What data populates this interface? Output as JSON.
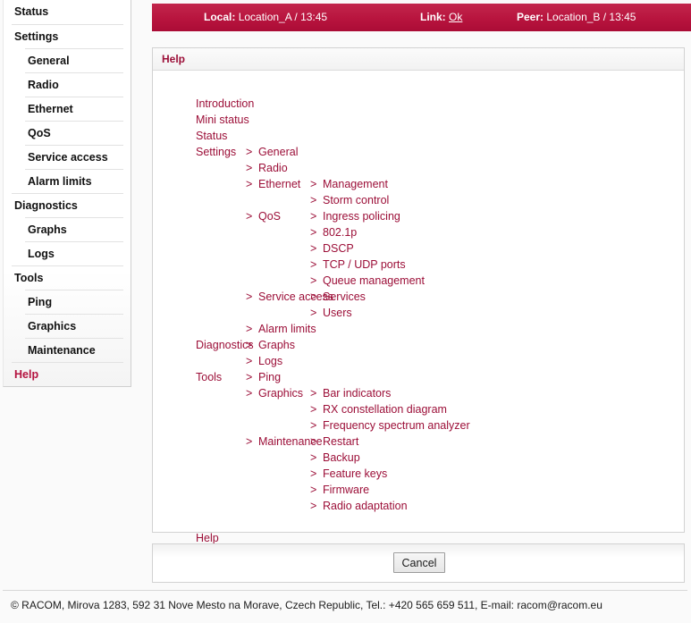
{
  "statusbar": {
    "local_key": "Local:",
    "local_value": "Location_A / 13:45",
    "link_key": "Link:",
    "link_value": "Ok",
    "peer_key": "Peer:",
    "peer_value": "Location_B / 13:45",
    "accent_color": "#b8143e"
  },
  "sidebar": {
    "items": [
      {
        "label": "Status",
        "level": 0,
        "active": false
      },
      {
        "label": "Settings",
        "level": 0,
        "active": false
      },
      {
        "label": "General",
        "level": 1,
        "active": false
      },
      {
        "label": "Radio",
        "level": 1,
        "active": false
      },
      {
        "label": "Ethernet",
        "level": 1,
        "active": false
      },
      {
        "label": "QoS",
        "level": 1,
        "active": false
      },
      {
        "label": "Service access",
        "level": 1,
        "active": false
      },
      {
        "label": "Alarm limits",
        "level": 1,
        "active": false
      },
      {
        "label": "Diagnostics",
        "level": 0,
        "active": false
      },
      {
        "label": "Graphs",
        "level": 1,
        "active": false
      },
      {
        "label": "Logs",
        "level": 1,
        "active": false
      },
      {
        "label": "Tools",
        "level": 0,
        "active": false
      },
      {
        "label": "Ping",
        "level": 1,
        "active": false
      },
      {
        "label": "Graphics",
        "level": 1,
        "active": false
      },
      {
        "label": "Maintenance",
        "level": 1,
        "active": false
      },
      {
        "label": "Help",
        "level": 0,
        "active": true
      }
    ]
  },
  "panel": {
    "title": "Help",
    "title_color": "#9c0f38",
    "link_color": "#9c0f38",
    "separator": ">"
  },
  "help_tree": {
    "rows": [
      {
        "col0": "Introduction"
      },
      {
        "col0": "Mini status"
      },
      {
        "col0": "Status"
      },
      {
        "col0": "Settings",
        "col1": "General"
      },
      {
        "col1": "Radio"
      },
      {
        "col1": "Ethernet",
        "col2": "Management"
      },
      {
        "col2": "Storm control"
      },
      {
        "col1": "QoS",
        "col2": "Ingress policing"
      },
      {
        "col2": "802.1p"
      },
      {
        "col2": "DSCP"
      },
      {
        "col2": "TCP / UDP ports"
      },
      {
        "col2": "Queue management"
      },
      {
        "col1": "Service access",
        "col2": "Services"
      },
      {
        "col2": "Users"
      },
      {
        "col1": "Alarm limits"
      },
      {
        "col0": "Diagnostics",
        "col1": "Graphs"
      },
      {
        "col1": "Logs"
      },
      {
        "col0": "Tools",
        "col1": "Ping"
      },
      {
        "col1": "Graphics",
        "col2": "Bar indicators"
      },
      {
        "col2": "RX constellation diagram"
      },
      {
        "col2": "Frequency spectrum analyzer"
      },
      {
        "col1": "Maintenance",
        "col2": "Restart"
      },
      {
        "col2": "Backup"
      },
      {
        "col2": "Feature keys"
      },
      {
        "col2": "Firmware"
      },
      {
        "col2": "Radio adaptation"
      },
      {
        "col0": ""
      },
      {
        "col0": "Help"
      }
    ]
  },
  "actions": {
    "cancel_label": "Cancel"
  },
  "footer": {
    "text": "© RACOM, Mirova 1283, 592 31 Nove Mesto na Morave, Czech Republic, Tel.: +420 565 659 511, E-mail: racom@racom.eu"
  }
}
